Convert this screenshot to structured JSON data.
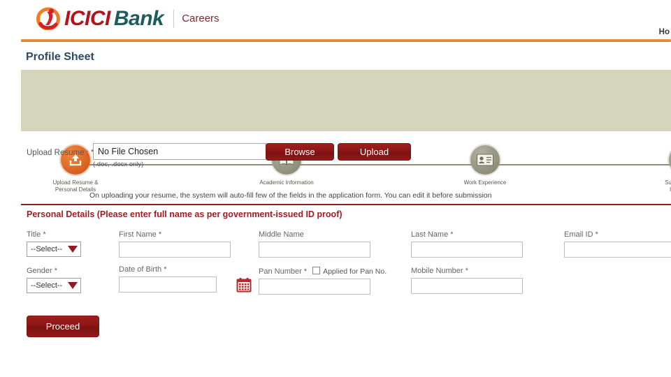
{
  "header": {
    "logo_icici": "ICICI",
    "logo_bank": "Bank",
    "careers": "Careers",
    "home_link": "Ho"
  },
  "page_title": "Profile Sheet",
  "stepper": {
    "steps": [
      {
        "label": "Upload Resume &\nPersonal Details",
        "icon": "upload-icon",
        "active": true
      },
      {
        "label": "Academic Information",
        "icon": "book-icon",
        "active": false
      },
      {
        "label": "Work Experience",
        "icon": "id-card-icon",
        "active": false
      },
      {
        "label": "Supplementary\nInformation",
        "icon": "document-icon",
        "active": false
      }
    ]
  },
  "upload": {
    "label": "Upload Resume : *",
    "file_value": "No File Chosen",
    "hint": "(.doc, .docx only)",
    "browse_label": "Browse",
    "upload_label": "Upload",
    "note": "On uploading your resume, the system will auto-fill few of the fields in the application form. You can edit it before submission"
  },
  "personal_details": {
    "section_title": "Personal Details (Please enter full name as per government-issued ID proof)",
    "title_label": "Title *",
    "title_value": "--Select--",
    "first_name_label": "First Name *",
    "first_name_value": "",
    "middle_name_label": "Middle Name",
    "middle_name_value": "",
    "last_name_label": "Last Name *",
    "last_name_value": "",
    "email_label": "Email ID *",
    "email_value": "",
    "gender_label": "Gender *",
    "gender_value": "--Select--",
    "dob_label": "Date of Birth *",
    "dob_value": "",
    "pan_label": "Pan Number *",
    "pan_value": "",
    "pan_checkbox_label": "Applied for Pan No.",
    "mobile_label": "Mobile Number *",
    "mobile_value": ""
  },
  "proceed_label": "Proceed",
  "colors": {
    "brand_red": "#b5121b",
    "brand_teal": "#1c5b5e",
    "accent_orange": "#d9761e",
    "button_red": "#8f1616",
    "stepper_bg": "#d5d4bd",
    "title_blue": "#2e4a62",
    "section_red": "#a31c22"
  }
}
